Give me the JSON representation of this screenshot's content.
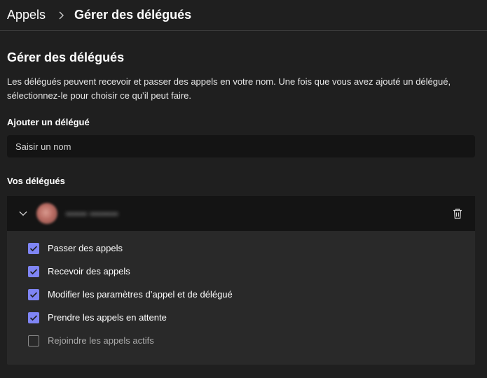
{
  "breadcrumb": {
    "root": "Appels",
    "current": "Gérer des délégués"
  },
  "main": {
    "title": "Gérer des délégués",
    "description": "Les délégués peuvent recevoir et passer des appels en votre nom. Une fois que vous avez ajouté un délégué, sélectionnez-le pour choisir ce qu’il peut faire.",
    "add_label": "Ajouter un délégué",
    "add_placeholder": "Saisir un nom",
    "delegates_label": "Vos délégués"
  },
  "delegate": {
    "name": "•••••• ••••••••"
  },
  "permissions": [
    {
      "label": "Passer des appels",
      "checked": true
    },
    {
      "label": "Recevoir des appels",
      "checked": true
    },
    {
      "label": "Modifier les paramètres d’appel et de délégué",
      "checked": true
    },
    {
      "label": "Prendre les appels en attente",
      "checked": true
    },
    {
      "label": "Rejoindre les appels actifs",
      "checked": false
    }
  ],
  "icons": {
    "breadcrumb_separator": "chevron-right-icon",
    "expand": "chevron-down-icon",
    "delete": "trash-icon",
    "check": "checkmark-icon"
  },
  "colors": {
    "background": "#1f1f1f",
    "input_background": "#141414",
    "card_background": "#292929",
    "accent": "#7f85f5"
  }
}
